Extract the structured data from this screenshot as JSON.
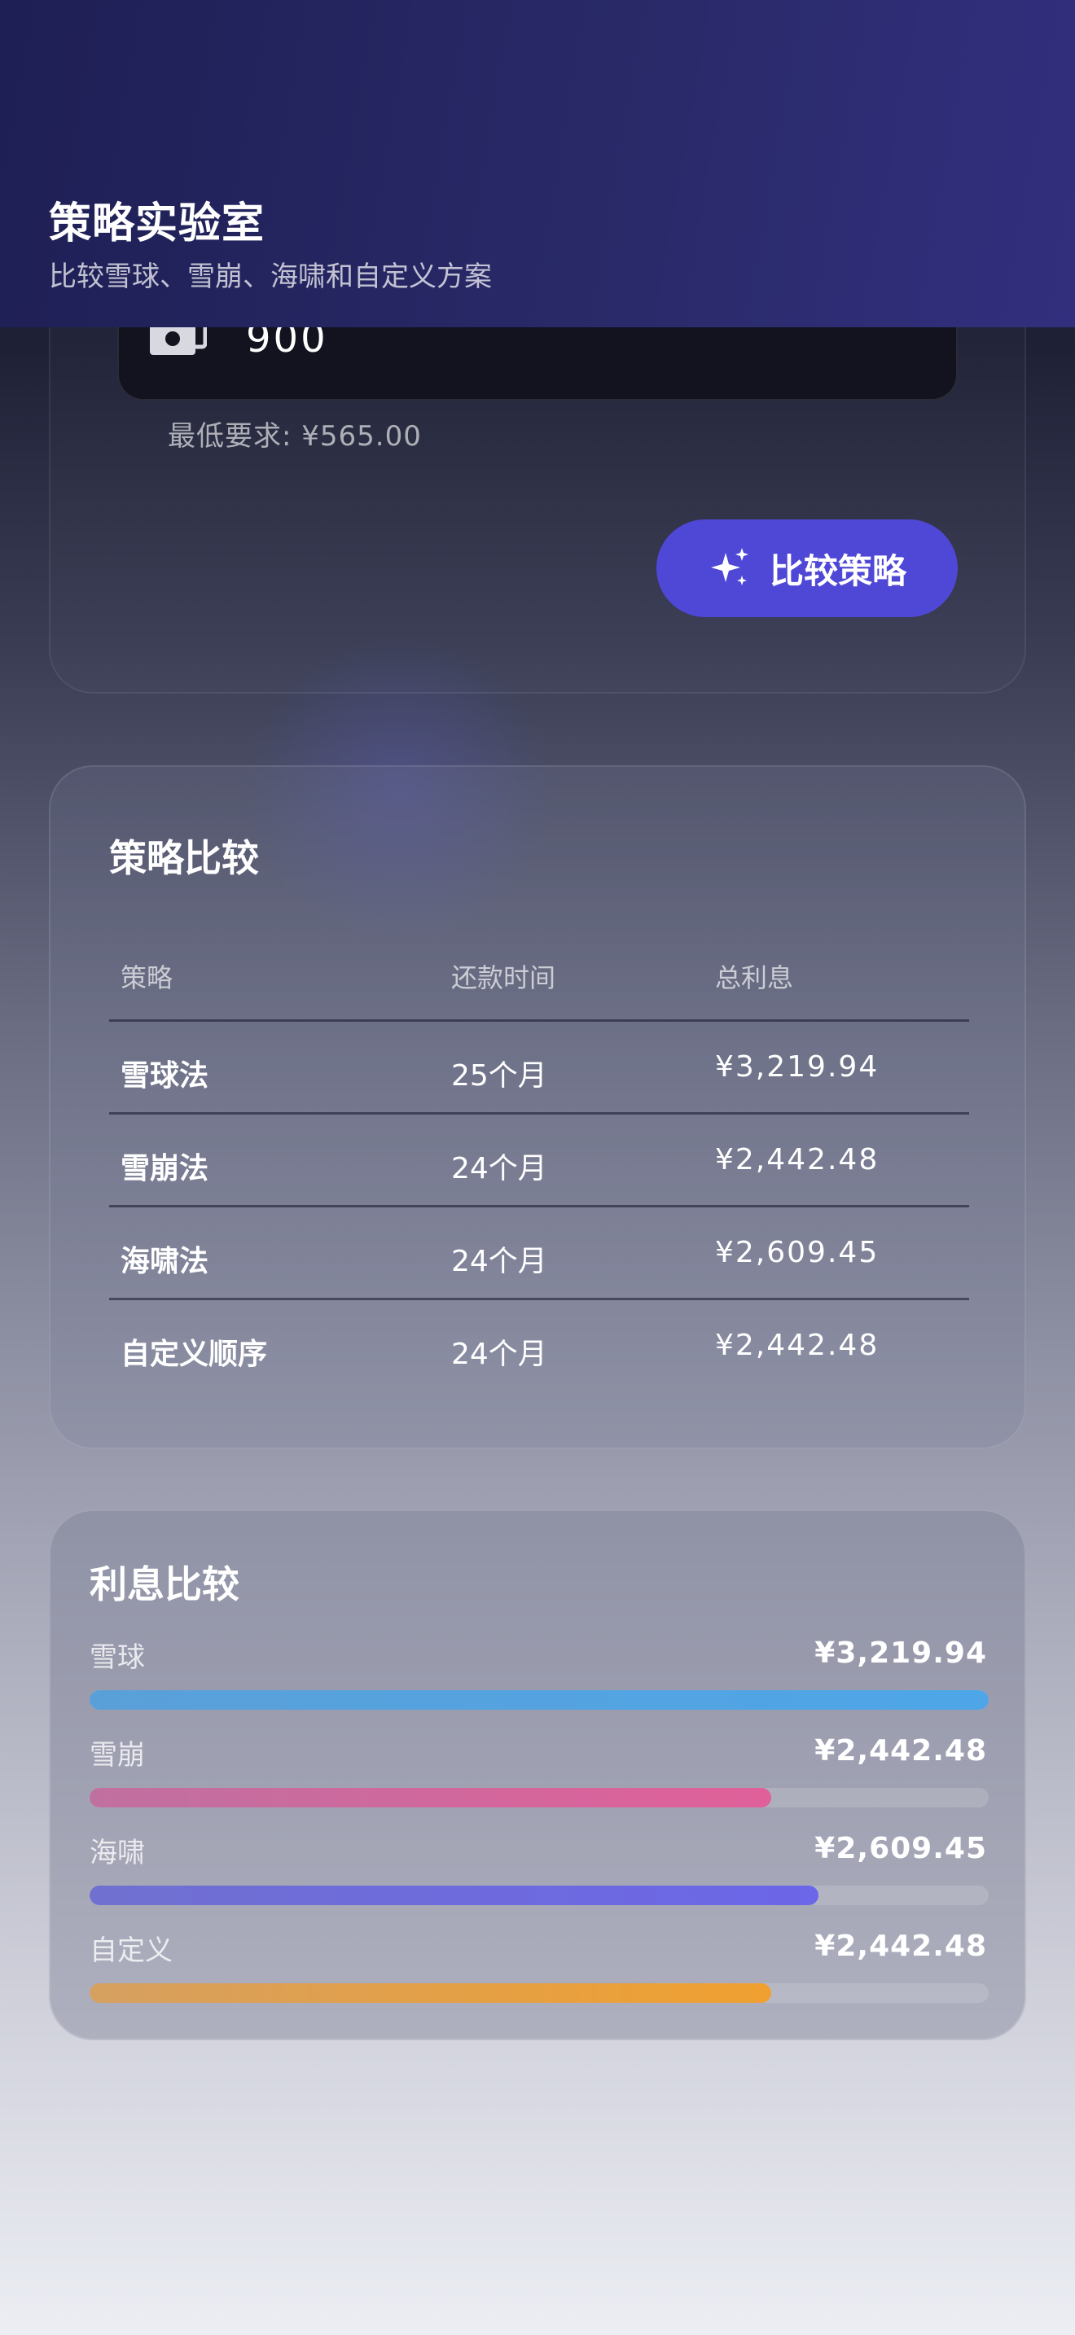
{
  "header": {
    "title": "策略实验室",
    "subtitle": "比较雪球、雪崩、海啸和自定义方案"
  },
  "input": {
    "amount": "900",
    "min_requirement": "最低要求: ¥565.00",
    "compare_button": "比较策略",
    "money_icon": "money-icon",
    "sparkle_icon": "sparkles-icon"
  },
  "comparison": {
    "title": "策略比较",
    "headers": [
      "策略",
      "还款时间",
      "总利息"
    ],
    "rows": [
      {
        "strategy": "雪球法",
        "time": "25个月",
        "interest": "¥3,219.94"
      },
      {
        "strategy": "雪崩法",
        "time": "24个月",
        "interest": "¥2,442.48"
      },
      {
        "strategy": "海啸法",
        "time": "24个月",
        "interest": "¥2,609.45"
      },
      {
        "strategy": "自定义顺序",
        "time": "24个月",
        "interest": "¥2,442.48"
      }
    ]
  },
  "interest": {
    "title": "利息比较",
    "items": [
      {
        "label": "雪球",
        "value": "¥3,219.94",
        "amount": 3219.94,
        "color_from": "#5aa0d8",
        "color_to": "#4ea6e8"
      },
      {
        "label": "雪崩",
        "value": "¥2,442.48",
        "amount": 2442.48,
        "color_from": "#c070a0",
        "color_to": "#e0609a"
      },
      {
        "label": "海啸",
        "value": "¥2,609.45",
        "amount": 2609.45,
        "color_from": "#7070d0",
        "color_to": "#6c66e8"
      },
      {
        "label": "自定义",
        "value": "¥2,442.48",
        "amount": 2442.48,
        "color_from": "#d6a060",
        "color_to": "#f0a030"
      }
    ]
  }
}
